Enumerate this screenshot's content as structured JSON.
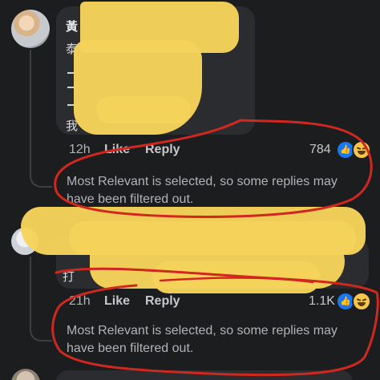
{
  "comment_1": {
    "name_glyph": "黃",
    "body_glyphs": [
      "泰",
      "我"
    ],
    "time": "12h",
    "like_label": "Like",
    "reply_label": "Reply",
    "reaction_count": "784",
    "reactions": [
      "like-reaction",
      "haha-reaction"
    ]
  },
  "filter_note_1": {
    "line_1": "Most Relevant is selected, so some replies may",
    "line_2": "have been filtered out."
  },
  "comment_2": {
    "body_glyphs": [
      "打"
    ],
    "time": "21h",
    "like_label": "Like",
    "reply_label": "Reply",
    "reaction_count": "1.1K",
    "reactions": [
      "like-reaction",
      "haha-reaction"
    ]
  },
  "filter_note_2": {
    "line_1": "Most Relevant is selected, so some replies may",
    "line_2": "have been filtered out."
  },
  "colors": {
    "background": "#1c1d1f",
    "bubble": "#2b2c2f",
    "redaction": "#f5d35a",
    "annotation": "#d0281f",
    "like_blue": "#1877f2"
  }
}
